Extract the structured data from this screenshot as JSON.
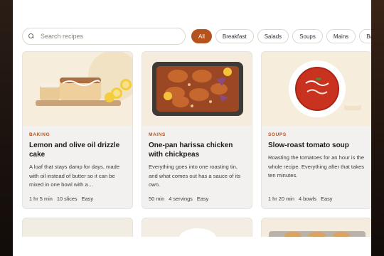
{
  "search": {
    "placeholder": "Search recipes",
    "value": ""
  },
  "filters": [
    "All",
    "Breakfast",
    "Salads",
    "Soups",
    "Mains",
    "Baking"
  ],
  "active_filter": "All",
  "colors": {
    "accent": "#b5531f",
    "card_bg": "#f2f1ef",
    "image_bg": "#f6eddc"
  },
  "recipes": [
    {
      "category": "BAKING",
      "title": "Lemon and olive oil drizzle cake",
      "description": "A loaf that stays damp for days, made with oil instead of butter so it can be mixed in one bowl with a…",
      "time": "1 hr 5 min",
      "yield": "10 slices",
      "difficulty": "Easy",
      "image": "loaf-cake-illustration"
    },
    {
      "category": "MAINS",
      "title": "One-pan harissa chicken with chickpeas",
      "description": "Everything goes into one roasting tin, and what comes out has a sauce of its own.",
      "time": "50 min",
      "yield": "4 servings",
      "difficulty": "Easy",
      "image": "roasting-tin-illustration"
    },
    {
      "category": "SOUPS",
      "title": "Slow-roast tomato soup",
      "description": "Roasting the tomatoes for an hour is the whole recipe. Everything after that takes ten minutes.",
      "time": "1 hr 20 min",
      "yield": "4 bowls",
      "difficulty": "Easy",
      "image": "tomato-soup-bowl-illustration"
    }
  ]
}
